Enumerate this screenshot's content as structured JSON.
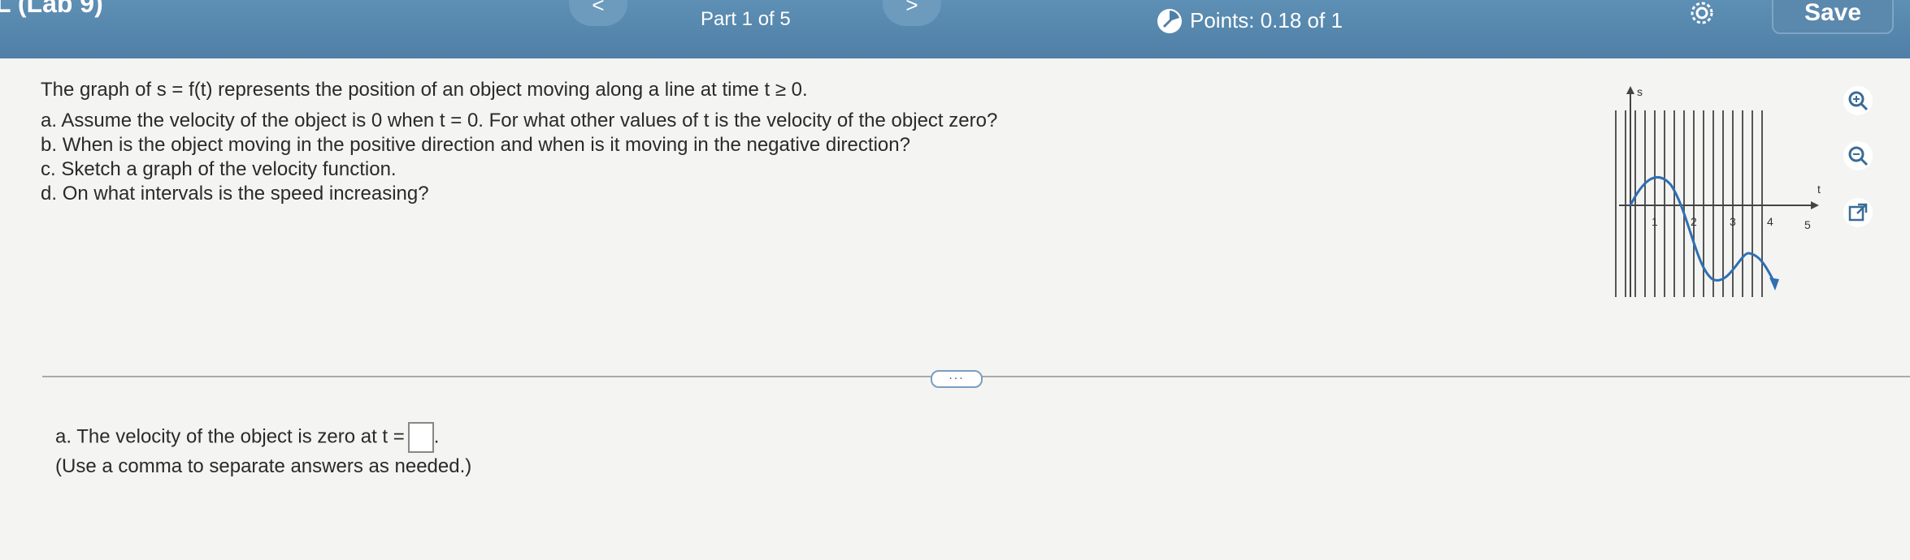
{
  "header": {
    "assignment_title": "L (Lab 9)",
    "prev_label": "<",
    "next_label": ">",
    "part_label": "Part 1 of 5",
    "points_label": "Points: 0.18 of 1",
    "save_label": "Save",
    "icons": {
      "settings": "gear-icon",
      "points": "partial-credit-icon"
    },
    "colors": {
      "bar": "#5485ad",
      "button": "#5b88ad"
    }
  },
  "question": {
    "intro": "The graph of s = f(t) represents the position of an object moving along a line at time t ≥ 0.",
    "parts": [
      {
        "letter": "a.",
        "text": "Assume the velocity of the object is 0 when t = 0. For what other values of t is the velocity of the object zero?"
      },
      {
        "letter": "b.",
        "text": "When is the object moving in the positive direction and when is it moving in the negative direction?"
      },
      {
        "letter": "c.",
        "text": "Sketch a graph of the velocity function."
      },
      {
        "letter": "d.",
        "text": "On what intervals is the speed increasing?"
      }
    ]
  },
  "graph": {
    "y_axis_label": "s",
    "x_axis_label": "t",
    "x_ticks": [
      "1",
      "2",
      "3",
      "4",
      "5"
    ],
    "curve_color": "#2f6fb3"
  },
  "tools": [
    "zoom-in-icon",
    "zoom-out-icon",
    "popout-icon"
  ],
  "more_button": "...",
  "answer": {
    "prompt": "a. The velocity of the object is zero at t =",
    "suffix": ".",
    "note": "(Use a comma to separate answers as needed.)",
    "value": ""
  }
}
